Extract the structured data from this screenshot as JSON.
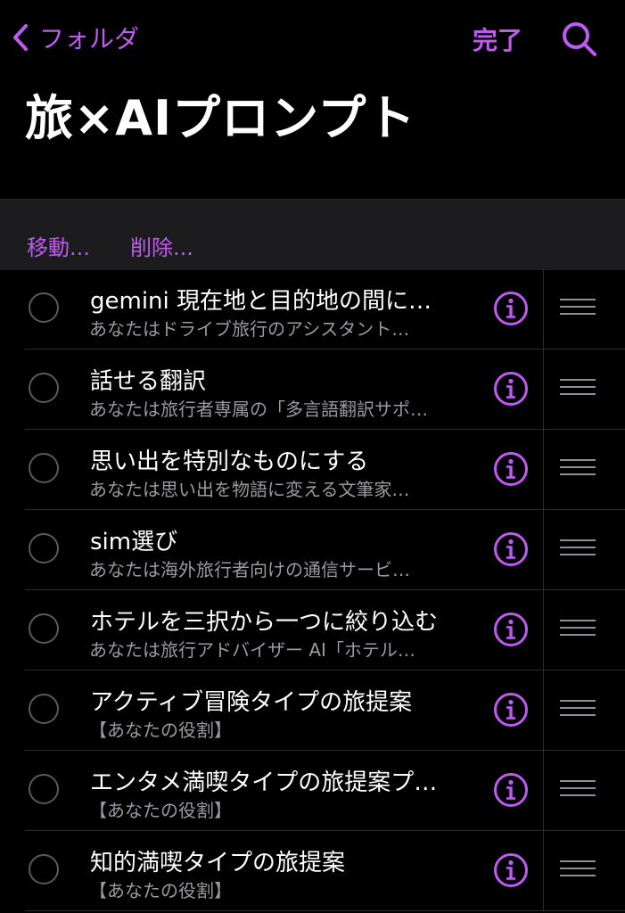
{
  "navbar": {
    "back_label": "フォルダ",
    "done_label": "完了",
    "back_icon": "chevron-left-icon",
    "search_icon": "search-icon",
    "accent_color": "#bf5af2"
  },
  "page": {
    "title": "旅×AIプロンプト"
  },
  "toolbar": {
    "move_label": "移動...",
    "delete_label": "削除..."
  },
  "notes": [
    {
      "title": "gemini 現在地と目的地の間に…",
      "subtitle": "あなたはドライブ旅行のアシスタント…"
    },
    {
      "title": "話せる翻訳",
      "subtitle": "あなたは旅行者専属の「多言語翻訳サポ…"
    },
    {
      "title": "思い出を特別なものにする",
      "subtitle": "あなたは思い出を物語に変える文筆家…"
    },
    {
      "title": "sim選び",
      "subtitle": "あなたは海外旅行者向けの通信サービ…"
    },
    {
      "title": "ホテルを三択から一つに絞り込む",
      "subtitle": "あなたは旅行アドバイザー AI「ホテル…"
    },
    {
      "title": "アクティブ冒険タイプの旅提案",
      "subtitle": "【あなたの役割】"
    },
    {
      "title": "エンタメ満喫タイプの旅提案プ…",
      "subtitle": "【あなたの役割】"
    },
    {
      "title": "知的満喫タイプの旅提案",
      "subtitle": "【あなたの役割】"
    }
  ]
}
